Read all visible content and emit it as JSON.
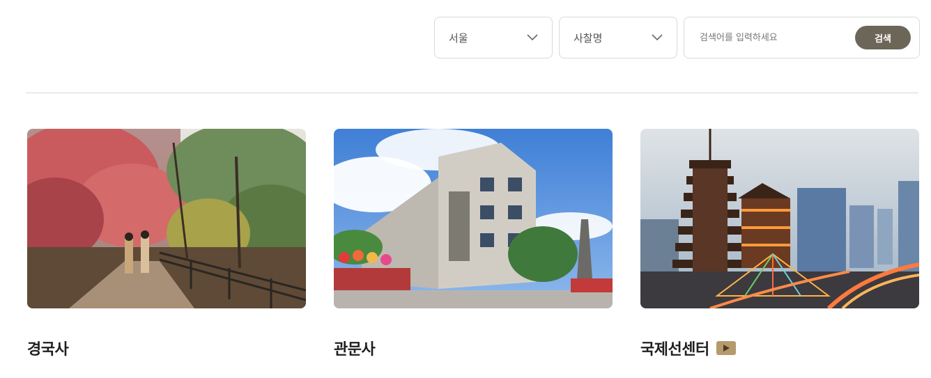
{
  "filters": {
    "region": {
      "selected": "서울"
    },
    "category": {
      "selected": "사찰명"
    },
    "search": {
      "placeholder": "검색어를 입력하세요",
      "value": "",
      "button_label": "검색"
    }
  },
  "cards": [
    {
      "name": "경국사",
      "has_video": false
    },
    {
      "name": "관문사",
      "has_video": false
    },
    {
      "name": "국제선센터",
      "has_video": true
    }
  ],
  "colors": {
    "search_button": "#6b6658",
    "video_badge": "#b59a6b",
    "divider": "#d6d6d6"
  },
  "icons": {
    "dropdown": "chevron-down-icon",
    "video": "play-icon"
  }
}
